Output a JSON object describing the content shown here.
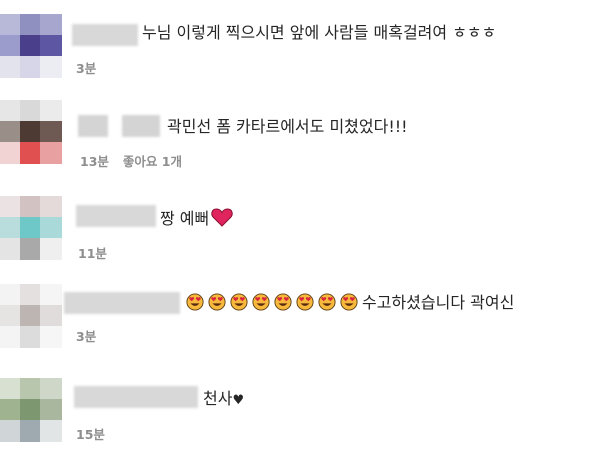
{
  "comments": [
    {
      "text": "누님 이렇게 찍으시면 앞에 사람들 매혹걸려여 ㅎㅎㅎ",
      "time": "3분",
      "likes": ""
    },
    {
      "text": "곽민선 폼 카타르에서도 미쳤었다!!!",
      "time": "13분",
      "likes": "좋아요 1개"
    },
    {
      "text": "짱 예뻐",
      "time": "11분",
      "likes": "",
      "icon": "red-heart-emoji"
    },
    {
      "text": "수고하셨습니다 곽여신",
      "time": "3분",
      "likes": "",
      "icon": "heart-eyes-emoji",
      "icon_count": 8
    },
    {
      "text": "천사",
      "time": "15분",
      "likes": "",
      "icon": "black-heart-suit"
    }
  ],
  "colors": {
    "text": "#262626",
    "meta": "#8e8e8e",
    "heart": "#e0245e"
  }
}
